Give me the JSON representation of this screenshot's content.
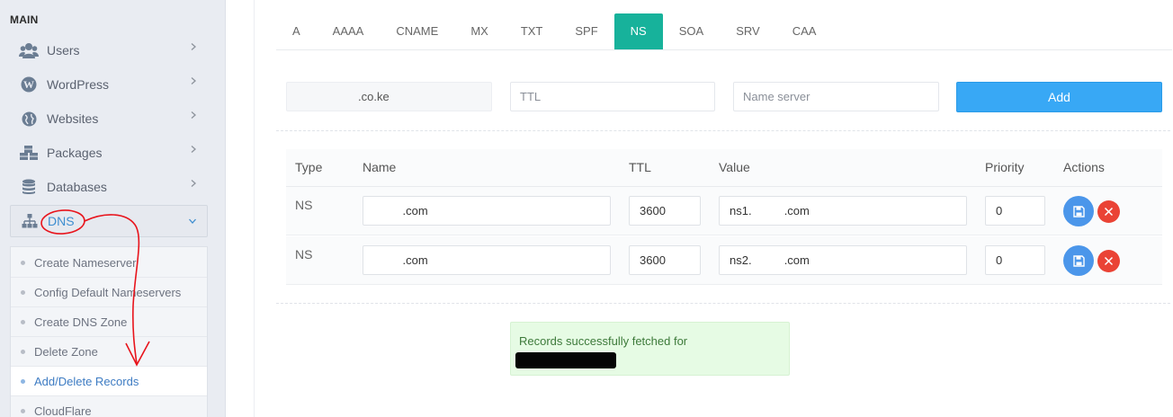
{
  "sidebar": {
    "section_title": "MAIN",
    "items": [
      {
        "label": "Users",
        "icon": "users-icon"
      },
      {
        "label": "WordPress",
        "icon": "wordpress-icon"
      },
      {
        "label": "Websites",
        "icon": "globe-icon"
      },
      {
        "label": "Packages",
        "icon": "cubes-icon"
      },
      {
        "label": "Databases",
        "icon": "database-icon"
      },
      {
        "label": "DNS",
        "icon": "sitemap-icon"
      }
    ],
    "dns_submenu": [
      {
        "label": "Create Nameserver"
      },
      {
        "label": "Config Default Nameservers"
      },
      {
        "label": "Create DNS Zone"
      },
      {
        "label": "Delete Zone"
      },
      {
        "label": "Add/Delete Records"
      },
      {
        "label": "CloudFlare"
      }
    ]
  },
  "tabs": [
    "A",
    "AAAA",
    "CNAME",
    "MX",
    "TXT",
    "SPF",
    "NS",
    "SOA",
    "SRV",
    "CAA"
  ],
  "active_tab": "NS",
  "form": {
    "domain_value": ".co.ke",
    "ttl_placeholder": "TTL",
    "nameserver_placeholder": "Name server",
    "add_label": "Add"
  },
  "table": {
    "headers": {
      "type": "Type",
      "name": "Name",
      "ttl": "TTL",
      "value": "Value",
      "priority": "Priority",
      "actions": "Actions"
    },
    "rows": [
      {
        "type": "NS",
        "name": "         .com",
        "ttl": "3600",
        "value": "ns1.          .com",
        "priority": "0"
      },
      {
        "type": "NS",
        "name": "         .com",
        "ttl": "3600",
        "value": "ns2.          .com",
        "priority": "0"
      }
    ]
  },
  "alert": {
    "message": "Records successfully fetched for"
  },
  "colors": {
    "accent_tab": "#17b29b",
    "add_button": "#38a8f5",
    "save_button": "#4b96ea",
    "delete_button": "#ea4335",
    "annotation": "#e8141c"
  }
}
